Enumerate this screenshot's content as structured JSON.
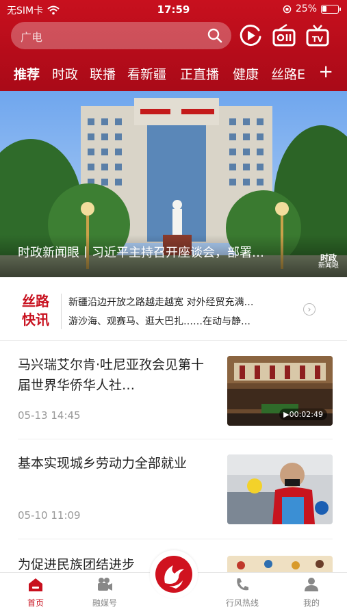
{
  "status_bar": {
    "carrier": "无SIM卡",
    "time": "17:59",
    "battery": "25%"
  },
  "search": {
    "placeholder": "广电"
  },
  "top_icons": [
    "play-circle-icon",
    "radio-icon",
    "tv-icon"
  ],
  "nav_tabs": [
    {
      "label": "推荐",
      "active": true
    },
    {
      "label": "时政"
    },
    {
      "label": "联播"
    },
    {
      "label": "看新疆"
    },
    {
      "label": "正直播"
    },
    {
      "label": "健康"
    },
    {
      "label": "丝路E"
    }
  ],
  "nav_plus": "+",
  "hero": {
    "caption": "时政新闻眼丨习近平主持召开座谈会，部署…",
    "logo_lines": [
      "时政",
      "新闻眼"
    ]
  },
  "silk_flash": {
    "brand_line1": "丝路",
    "brand_line2": "快讯",
    "lines": [
      "新疆沿边开放之路越走越宽  对外经贸充满…",
      "游沙海、观赛马、逛大巴扎……在动与静…"
    ]
  },
  "news": [
    {
      "title": "马兴瑞艾尔肯·吐尼亚孜会见第十届世界华侨华人社…",
      "time": "05-13  14:45",
      "duration": "▶00:02:49"
    },
    {
      "title": "基本实现城乡劳动力全部就业",
      "time": "05-10  11:09"
    },
    {
      "title": "为促进民族团结进步"
    }
  ],
  "tabbar": {
    "home": "首页",
    "media": "融媒号",
    "hotline": "行风热线",
    "mine": "我的"
  },
  "colors": {
    "brand_red": "#c8101e",
    "text_dark": "#222222",
    "text_muted": "#999999"
  }
}
